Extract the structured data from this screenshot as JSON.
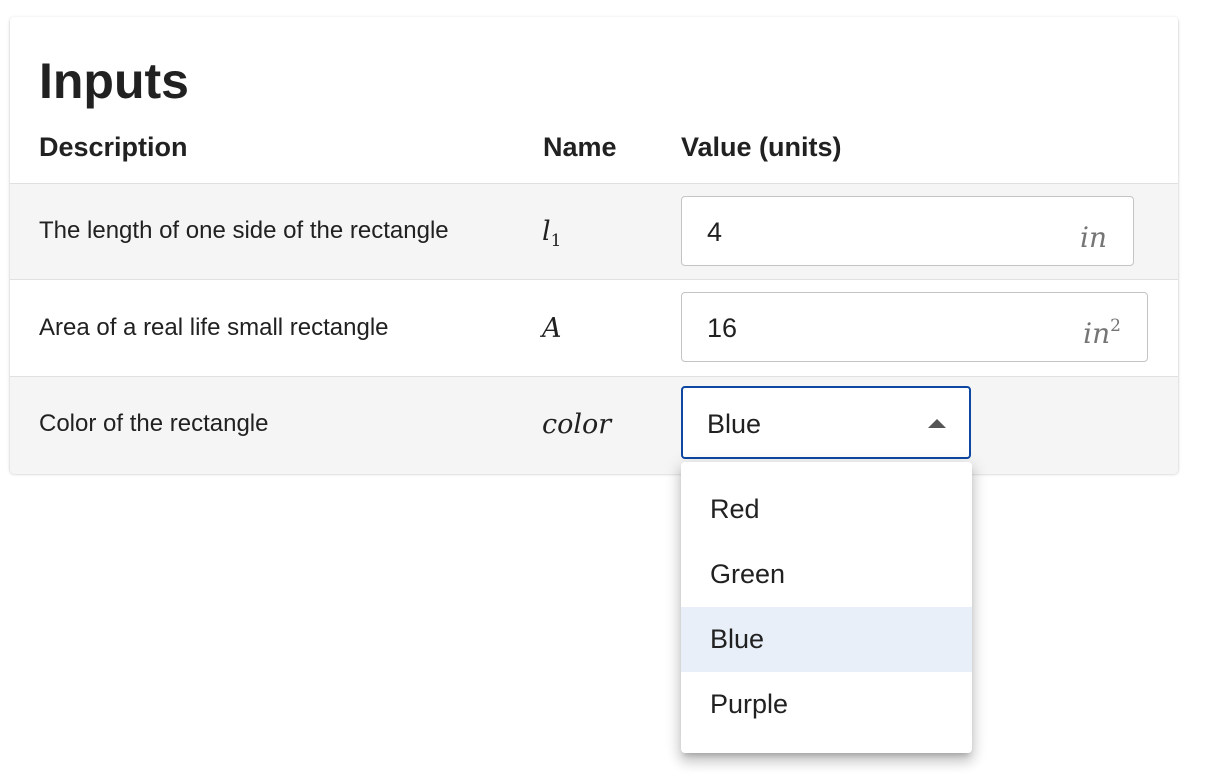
{
  "card": {
    "title": "Inputs",
    "headers": {
      "description": "Description",
      "name": "Name",
      "value": "Value (units)"
    }
  },
  "rows": [
    {
      "description": "The length of one side of the rectangle",
      "name_base": "l",
      "name_sub": "1",
      "value": "4",
      "unit_base": "in",
      "unit_sup": ""
    },
    {
      "description": "Area of a real life small rectangle",
      "name_base": "A",
      "name_sub": "",
      "value": "16",
      "unit_base": "in",
      "unit_sup": "2"
    },
    {
      "description": "Color of the rectangle",
      "name_base": "color",
      "name_sub": "",
      "value": "Blue",
      "options": [
        "Red",
        "Green",
        "Blue",
        "Purple"
      ],
      "selected_index": 2
    }
  ],
  "colors": {
    "focus_border": "#0d47a1",
    "selected_option_bg": "#e8eff8",
    "shaded_row_bg": "#f5f5f5"
  },
  "icons": {
    "select_caret": "caret-up-icon"
  }
}
